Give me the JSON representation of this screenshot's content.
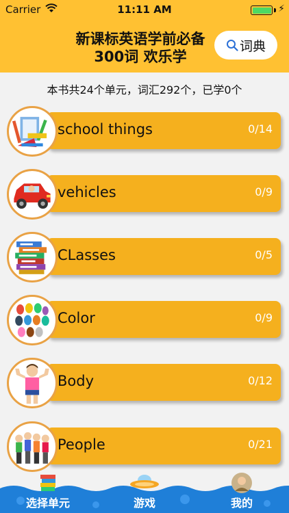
{
  "status_bar": {
    "carrier": "Carrier",
    "time": "11:11 AM"
  },
  "header": {
    "title": "新课标英语学前必备300词 欢乐学",
    "dict_button": "词典"
  },
  "summary": "本书共24个单元，词汇292个，已学0个",
  "units": [
    {
      "name": "school things",
      "progress": "0/14",
      "icon": "school-supplies-icon"
    },
    {
      "name": "vehicles",
      "progress": "0/9",
      "icon": "car-icon"
    },
    {
      "name": "CLasses",
      "progress": "0/5",
      "icon": "books-icon"
    },
    {
      "name": "Color",
      "progress": "0/9",
      "icon": "color-eggs-icon"
    },
    {
      "name": "Body",
      "progress": "0/12",
      "icon": "body-boy-icon"
    },
    {
      "name": "People",
      "progress": "0/21",
      "icon": "people-group-icon"
    }
  ],
  "tabs": [
    {
      "label": "选择单元",
      "icon": "books-stack-icon"
    },
    {
      "label": "游戏",
      "icon": "ufo-icon"
    },
    {
      "label": "我的",
      "icon": "profile-icon"
    }
  ],
  "colors": {
    "header": "#ffc132",
    "unit_bar": "#f5b01e",
    "tab_bar": "#1f7fd8"
  }
}
